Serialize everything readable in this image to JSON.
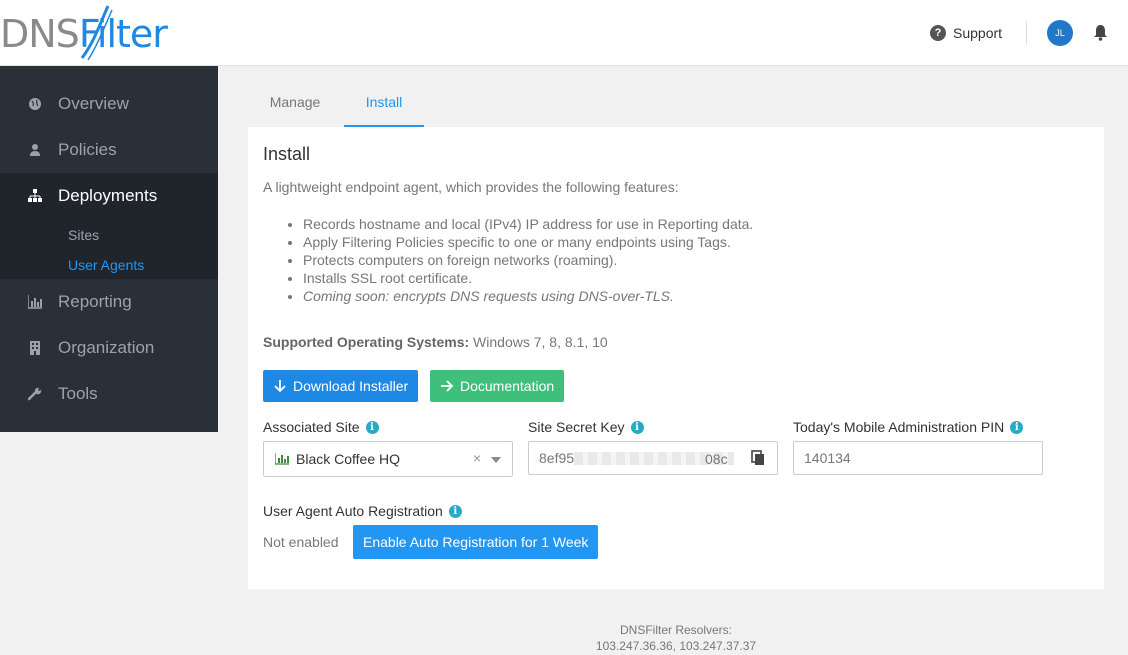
{
  "header": {
    "logo_text_dns": "DNS",
    "logo_text_filter": "Filter",
    "support_label": "Support",
    "avatar_initials": "JL"
  },
  "sidebar": {
    "items": [
      {
        "label": "Overview",
        "icon": "globe-icon"
      },
      {
        "label": "Policies",
        "icon": "user-icon"
      },
      {
        "label": "Deployments",
        "icon": "sitemap-icon"
      },
      {
        "label": "Reporting",
        "icon": "bar-chart-icon"
      },
      {
        "label": "Organization",
        "icon": "building-icon"
      },
      {
        "label": "Tools",
        "icon": "wrench-icon"
      }
    ],
    "subitems": [
      {
        "label": "Sites"
      },
      {
        "label": "User Agents"
      }
    ]
  },
  "tabs": [
    {
      "label": "Manage"
    },
    {
      "label": "Install"
    }
  ],
  "card": {
    "title": "Install",
    "description": "A lightweight endpoint agent, which provides the following features:",
    "features": [
      "Records hostname and local (IPv4) IP address for use in Reporting data.",
      "Apply Filtering Policies specific to one or many endpoints using Tags.",
      "Protects computers on foreign networks (roaming).",
      "Installs SSL root certificate.",
      "Coming soon: encrypts DNS requests using DNS-over-TLS."
    ],
    "os_label": "Supported Operating Systems:",
    "os_value": "Windows 7, 8, 8.1, 10",
    "download_button": "Download Installer",
    "documentation_button": "Documentation",
    "associated_site_label": "Associated Site",
    "associated_site_value": "Black Coffee HQ",
    "site_secret_key_label": "Site Secret Key",
    "site_secret_key_start": "8ef95",
    "site_secret_key_end": "08c",
    "mobile_pin_label": "Today's Mobile Administration PIN",
    "mobile_pin_value": "140134",
    "auto_reg_label": "User Agent Auto Registration",
    "auto_reg_status": "Not enabled",
    "auto_reg_button": "Enable Auto Registration for 1 Week"
  },
  "footer": {
    "resolvers_label": "DNSFilter Resolvers:",
    "resolvers_value": "103.247.36.36, 103.247.37.37"
  },
  "colors": {
    "accent": "#1e88e5",
    "success": "#3fc07a",
    "sidebar_bg": "#293038",
    "info": "#2aa9c6"
  }
}
